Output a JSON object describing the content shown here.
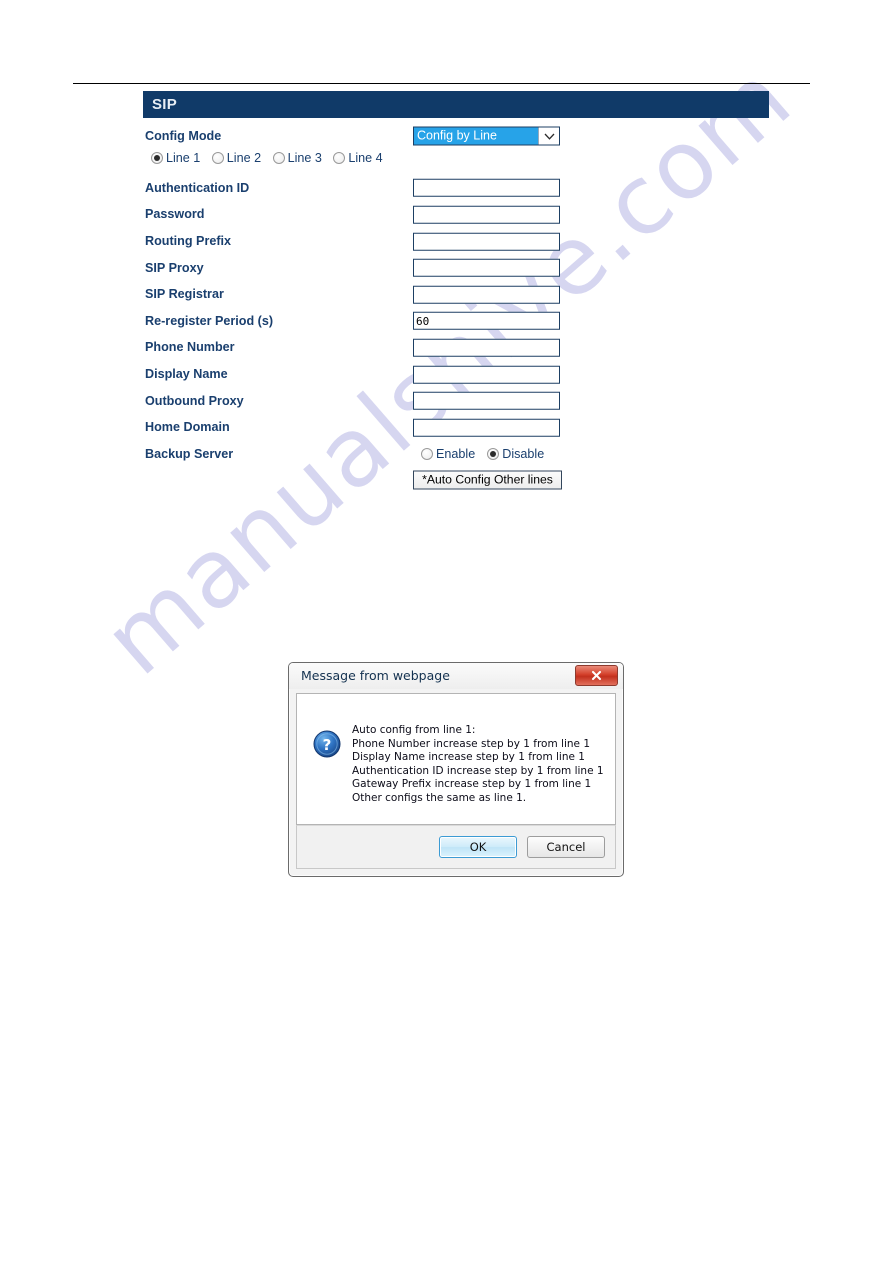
{
  "panel": {
    "title": "SIP",
    "rows": [
      {
        "label": "Config Mode",
        "type": "select"
      },
      {
        "label": "Authentication ID",
        "type": "text",
        "value": ""
      },
      {
        "label": "Password",
        "type": "text",
        "value": ""
      },
      {
        "label": "Routing Prefix",
        "type": "text",
        "value": ""
      },
      {
        "label": "SIP Proxy",
        "type": "text",
        "value": ""
      },
      {
        "label": "SIP Registrar",
        "type": "text",
        "value": ""
      },
      {
        "label": "Re-register Period (s)",
        "type": "text",
        "value": "60"
      },
      {
        "label": "Phone Number",
        "type": "text",
        "value": ""
      },
      {
        "label": "Display Name",
        "type": "text",
        "value": ""
      },
      {
        "label": "Outbound Proxy",
        "type": "text",
        "value": ""
      },
      {
        "label": "Home Domain",
        "type": "text",
        "value": ""
      },
      {
        "label": "Backup Server",
        "type": "radio"
      }
    ],
    "config_mode": {
      "selected": "Config by Line",
      "arrow_icon": "chevron-down-icon"
    },
    "line_radios": {
      "options": [
        "Line 1",
        "Line 2",
        "Line 3",
        "Line 4"
      ],
      "selected": "Line 1"
    },
    "backup_server": {
      "options": [
        "Enable",
        "Disable"
      ],
      "selected": "Disable"
    },
    "auto_config_button": "*Auto Config Other lines"
  },
  "dialog": {
    "title": "Message from webpage",
    "close_icon": "close-icon",
    "info_icon": "question-mark-icon",
    "message_lines": [
      "Auto config from line 1:",
      "Phone Number increase step by 1 from line 1",
      "Display Name increase step by 1 from line 1",
      "Authentication ID increase step by 1 from line 1",
      "Gateway Prefix increase step by 1 from line 1",
      "Other configs the same as line 1."
    ],
    "ok_label": "OK",
    "cancel_label": "Cancel"
  },
  "watermark": {
    "text": "manualshive.com"
  },
  "colors": {
    "header_bg": "#103a68",
    "label_text": "#1a3f6e",
    "select_highlight": "#27a3e8",
    "field_border": "#1d3f63",
    "watermark": "#cfcfee"
  }
}
